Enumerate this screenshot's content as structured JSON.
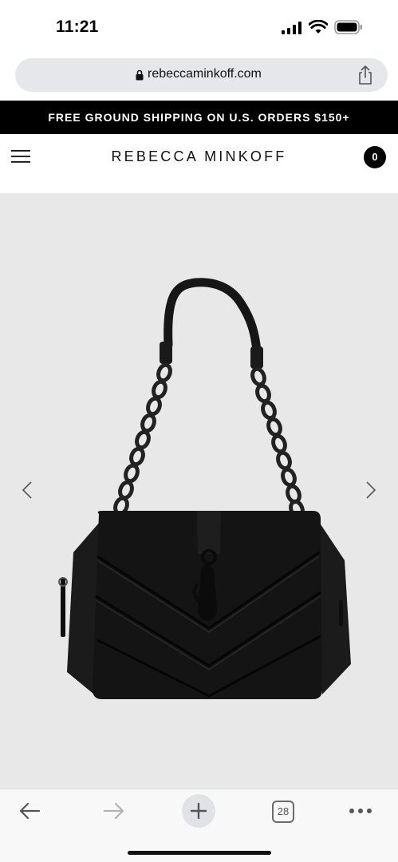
{
  "status_bar": {
    "time": "11:21",
    "icons": [
      "signal-icon",
      "wifi-icon",
      "battery-icon"
    ]
  },
  "browser": {
    "url": "rebeccaminkoff.com",
    "lock_icon": "lock-icon",
    "share_icon": "share-icon"
  },
  "promo": {
    "text": "FREE GROUND SHIPPING ON U.S. ORDERS $150+"
  },
  "header": {
    "brand": "REBECCA MINKOFF",
    "menu_icon": "hamburger-menu-icon",
    "cart_count": "0"
  },
  "gallery": {
    "background": "#e8e8e8",
    "product_color": "#141414",
    "prev_icon": "chevron-left-icon",
    "next_icon": "chevron-right-icon"
  },
  "toolbar": {
    "back_icon": "arrow-left-icon",
    "forward_icon": "arrow-right-icon",
    "new_tab_icon": "plus-icon",
    "tab_count": "28",
    "more_icon": "more-dots-icon"
  }
}
